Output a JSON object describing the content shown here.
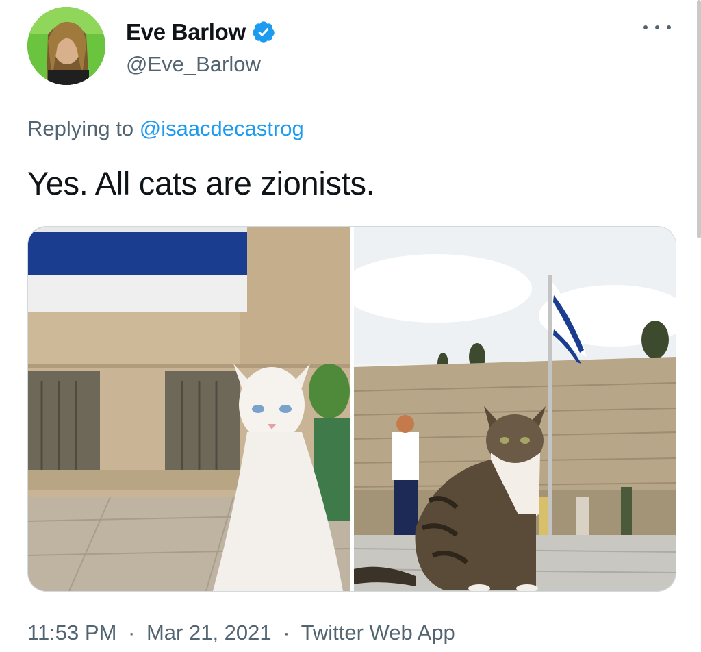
{
  "tweet": {
    "author": {
      "display_name": "Eve Barlow",
      "handle": "@Eve_Barlow",
      "verified": true
    },
    "replying_prefix": "Replying to",
    "replying_to": "@isaacdecastrog",
    "text": "Yes. All cats are zionists.",
    "meta": {
      "time": "11:53 PM",
      "date": "Mar 21, 2021",
      "client": "Twitter Web App",
      "separator": "·"
    },
    "media": [
      {
        "description_icon": "white-cat-photo"
      },
      {
        "description_icon": "tabby-cat-photo"
      }
    ]
  },
  "colors": {
    "text": "#0f1419",
    "secondary": "#536471",
    "accent": "#1d9bf0",
    "flag_blue": "#1a3d8f"
  }
}
